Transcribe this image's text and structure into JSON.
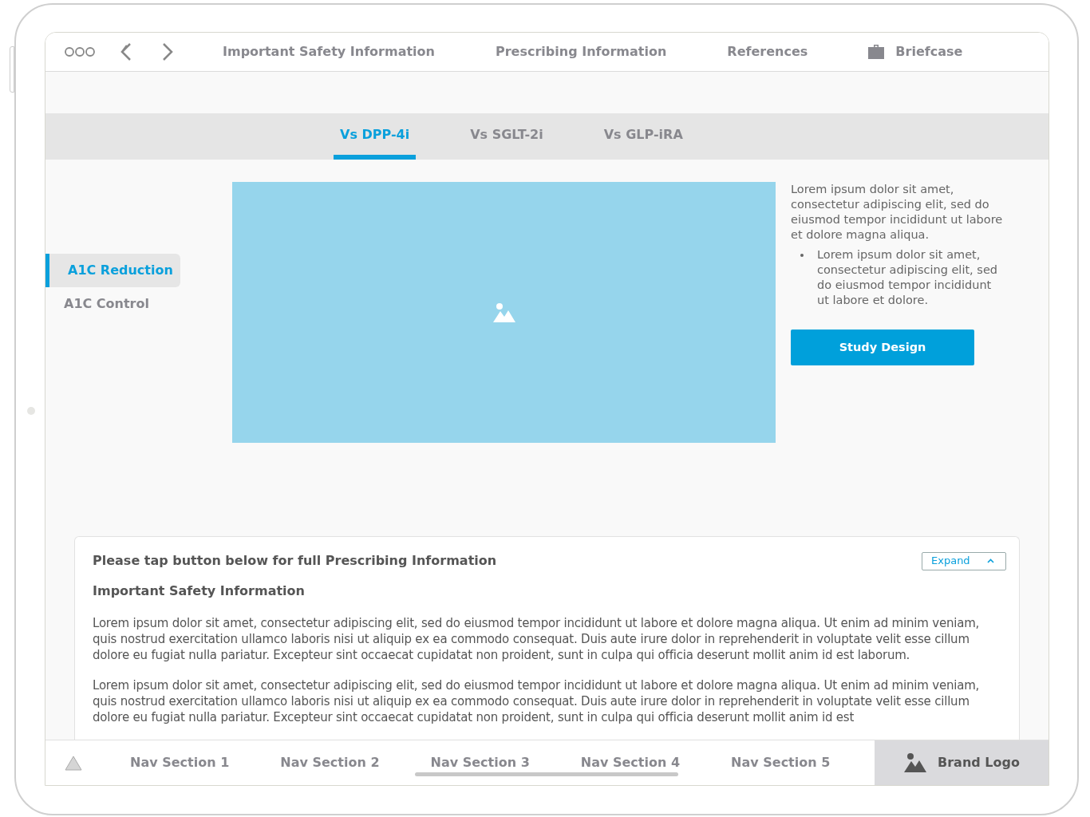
{
  "top_nav": {
    "links": [
      "Important Safety Information",
      "Prescribing Information",
      "References"
    ],
    "briefcase": "Briefcase"
  },
  "tabs": [
    {
      "label": "Vs DPP-4i",
      "selected": true
    },
    {
      "label": "Vs SGLT-2i",
      "selected": false
    },
    {
      "label": "Vs GLP-iRA",
      "selected": false
    }
  ],
  "sidebar": {
    "items": [
      {
        "label": "A1C Reduction",
        "selected": true
      },
      {
        "label": "A1C Control",
        "selected": false
      }
    ]
  },
  "content": {
    "paragraph": "Lorem ipsum dolor sit amet, consectetur adipiscing elit, sed do eiusmod tempor incididunt ut labore et dolore magna aliqua.",
    "bullets": [
      "Lorem ipsum dolor sit amet, consectetur adipiscing elit, sed do eiusmod tempor incididunt ut labore et dolore."
    ],
    "button": "Study Design"
  },
  "isi": {
    "header": "Please tap button below for full Prescribing Information",
    "expand": "Expand",
    "title": "Important Safety Information",
    "paragraphs": [
      "Lorem ipsum dolor sit amet, consectetur adipiscing elit, sed do eiusmod tempor incididunt ut labore et dolore magna aliqua. Ut enim ad minim veniam, quis nostrud exercitation ullamco laboris nisi ut aliquip ex ea commodo consequat. Duis aute irure dolor in reprehenderit in voluptate velit esse cillum dolore eu fugiat nulla pariatur. Excepteur sint occaecat cupidatat non proident, sunt in culpa qui officia deserunt mollit anim id est laborum.",
      "Lorem ipsum dolor sit amet, consectetur adipiscing elit, sed do eiusmod tempor incididunt ut labore et dolore magna aliqua. Ut enim ad minim veniam, quis nostrud exercitation ullamco laboris nisi ut aliquip ex ea commodo consequat. Duis aute irure dolor in reprehenderit in voluptate velit esse cillum dolore eu fugiat nulla pariatur. Excepteur sint occaecat cupidatat non proident, sunt in culpa qui officia deserunt mollit anim id est"
    ]
  },
  "bottom_nav": {
    "items": [
      "Nav Section 1",
      "Nav Section 2",
      "Nav Section 3",
      "Nav Section 4",
      "Nav Section 5"
    ],
    "brand": "Brand Logo"
  }
}
